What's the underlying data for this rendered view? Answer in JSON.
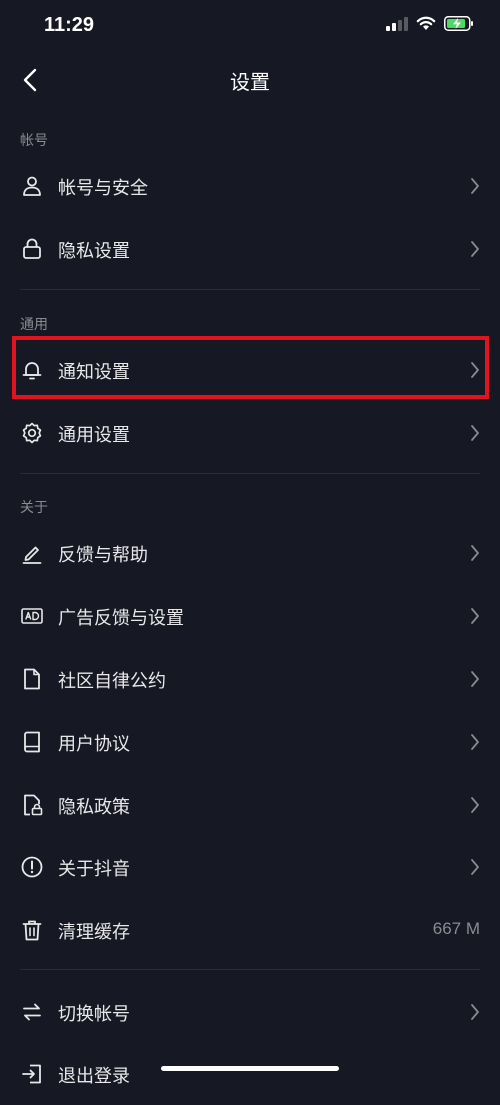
{
  "status_bar": {
    "time": "11:29"
  },
  "header": {
    "title": "设置"
  },
  "sections": {
    "account": {
      "header": "帐号",
      "items": [
        {
          "label": "帐号与安全",
          "icon": "user-icon"
        },
        {
          "label": "隐私设置",
          "icon": "lock-icon"
        }
      ]
    },
    "general": {
      "header": "通用",
      "items": [
        {
          "label": "通知设置",
          "icon": "bell-icon",
          "highlighted": true
        },
        {
          "label": "通用设置",
          "icon": "gear-icon"
        }
      ]
    },
    "about": {
      "header": "关于",
      "items": [
        {
          "label": "反馈与帮助",
          "icon": "pencil-icon"
        },
        {
          "label": "广告反馈与设置",
          "icon": "ad-icon"
        },
        {
          "label": "社区自律公约",
          "icon": "document-icon"
        },
        {
          "label": "用户协议",
          "icon": "book-icon"
        },
        {
          "label": "隐私政策",
          "icon": "document-lock-icon"
        },
        {
          "label": "关于抖音",
          "icon": "info-icon"
        },
        {
          "label": "清理缓存",
          "icon": "trash-icon",
          "value": "667 M"
        }
      ]
    },
    "bottom": {
      "items": [
        {
          "label": "切换帐号",
          "icon": "switch-icon"
        },
        {
          "label": "退出登录",
          "icon": "logout-icon"
        }
      ]
    }
  },
  "colors": {
    "background": "#161823",
    "text": "#e8e8ea",
    "secondary_text": "#8a8b91",
    "highlight_border": "#e0141e",
    "battery_fill": "#4cd964"
  }
}
